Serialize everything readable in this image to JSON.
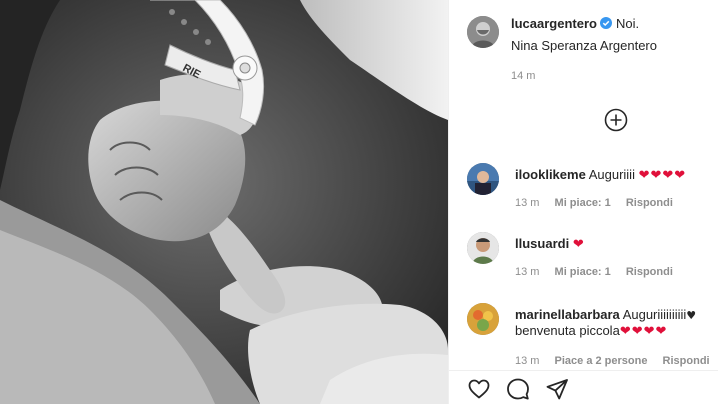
{
  "post": {
    "author": "lucaargentero",
    "caption_line1": "Noi.",
    "caption_line2": "Nina Speranza Argentero",
    "time": "14 m",
    "photo_bracelet_text": "RIE"
  },
  "comments": [
    {
      "user": "ilooklikeme",
      "text": "Auguriiii",
      "hearts": "❤❤❤❤",
      "time": "13 m",
      "likes": "Mi piace: 1",
      "reply": "Rispondi"
    },
    {
      "user": "llusuardi",
      "text": "",
      "hearts": "❤",
      "time": "13 m",
      "likes": "Mi piace: 1",
      "reply": "Rispondi"
    },
    {
      "user": "marinellabarbara",
      "text": "Auguriiiiiiiiii",
      "black_heart": "♥",
      "line2": "benvenuta piccola",
      "hearts2": "❤❤❤❤",
      "time": "13 m",
      "likes": "Piace a 2 persone",
      "reply": "Rispondi"
    }
  ],
  "icons": {
    "verified": "verified-badge-icon",
    "load_more": "plus-circle-icon",
    "like": "heart-outline-icon",
    "comment": "comment-bubble-icon",
    "share": "paper-plane-icon"
  },
  "colors": {
    "text": "#262626",
    "meta": "#8e8e8e",
    "verified": "#3897f0",
    "heart": "#e0103a"
  }
}
